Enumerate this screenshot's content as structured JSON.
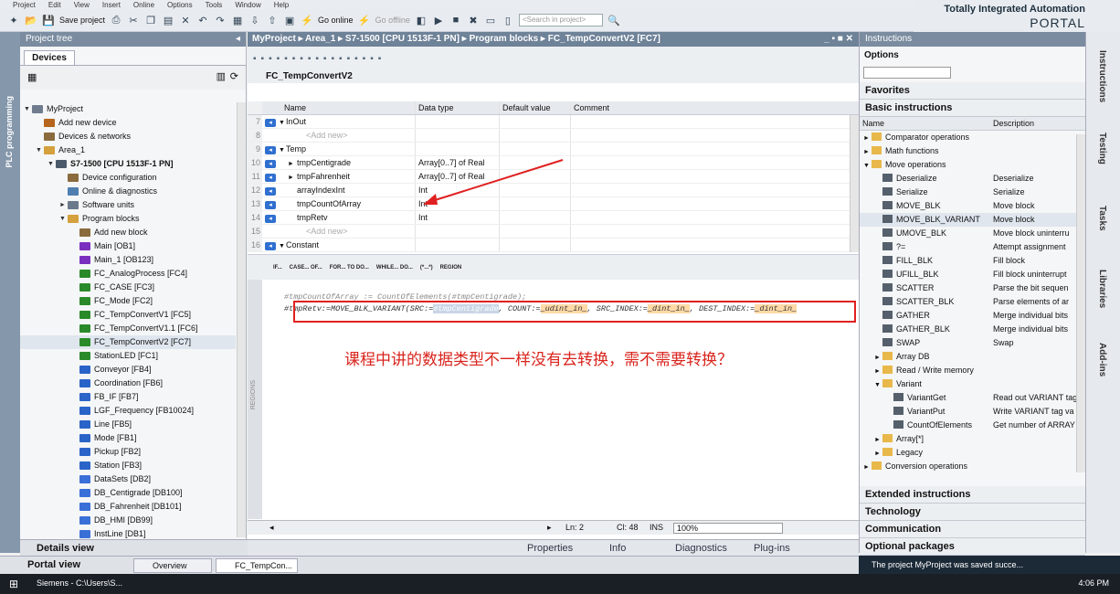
{
  "menu": [
    "Project",
    "Edit",
    "View",
    "Insert",
    "Online",
    "Options",
    "Tools",
    "Window",
    "Help"
  ],
  "toolbar": {
    "save": "Save project",
    "go_online": "Go online",
    "go_offline": "Go offline",
    "search_placeholder": "<Search in project>"
  },
  "brand": {
    "line1": "Totally Integrated Automation",
    "line2": "PORTAL"
  },
  "sidebar_label": "PLC programming",
  "project_tree": {
    "title": "Project tree",
    "tab": "Devices",
    "items": [
      {
        "label": "MyProject",
        "lvl": 0,
        "color": "#6e7c8e",
        "ar": "▼"
      },
      {
        "label": "Add new device",
        "lvl": 1,
        "color": "#b5651d",
        "ar": ""
      },
      {
        "label": "Devices & networks",
        "lvl": 1,
        "color": "#8a6b3d",
        "ar": ""
      },
      {
        "label": "Area_1",
        "lvl": 1,
        "color": "#d4a13d",
        "ar": "▼"
      },
      {
        "label": "S7-1500 [CPU 1513F-1 PN]",
        "lvl": 2,
        "color": "#4a5a6a",
        "ar": "▼",
        "bold": true
      },
      {
        "label": "Device configuration",
        "lvl": 3,
        "color": "#8a6b3d",
        "ar": ""
      },
      {
        "label": "Online & diagnostics",
        "lvl": 3,
        "color": "#4f7fb0",
        "ar": ""
      },
      {
        "label": "Software units",
        "lvl": 3,
        "color": "#6a7a8a",
        "ar": "►"
      },
      {
        "label": "Program blocks",
        "lvl": 3,
        "color": "#d4a13d",
        "ar": "▼"
      },
      {
        "label": "Add new block",
        "lvl": 4,
        "color": "#8a6b3d",
        "ar": ""
      },
      {
        "label": "Main [OB1]",
        "lvl": 4,
        "color": "#7b2fbf",
        "ar": ""
      },
      {
        "label": "Main_1 [OB123]",
        "lvl": 4,
        "color": "#7b2fbf",
        "ar": ""
      },
      {
        "label": "FC_AnalogProcess [FC4]",
        "lvl": 4,
        "color": "#2a8a2a",
        "ar": ""
      },
      {
        "label": "FC_CASE [FC3]",
        "lvl": 4,
        "color": "#2a8a2a",
        "ar": ""
      },
      {
        "label": "FC_Mode [FC2]",
        "lvl": 4,
        "color": "#2a8a2a",
        "ar": ""
      },
      {
        "label": "FC_TempConvertV1 [FC5]",
        "lvl": 4,
        "color": "#2a8a2a",
        "ar": ""
      },
      {
        "label": "FC_TempConvertV1.1 [FC6]",
        "lvl": 4,
        "color": "#2a8a2a",
        "ar": ""
      },
      {
        "label": "FC_TempConvertV2 [FC7]",
        "lvl": 4,
        "color": "#2a8a2a",
        "ar": "",
        "sel": true
      },
      {
        "label": "StationLED [FC1]",
        "lvl": 4,
        "color": "#2a8a2a",
        "ar": ""
      },
      {
        "label": "Conveyor [FB4]",
        "lvl": 4,
        "color": "#2a64c8",
        "ar": ""
      },
      {
        "label": "Coordination [FB6]",
        "lvl": 4,
        "color": "#2a64c8",
        "ar": ""
      },
      {
        "label": "FB_IF [FB7]",
        "lvl": 4,
        "color": "#2a64c8",
        "ar": ""
      },
      {
        "label": "LGF_Frequency [FB10024]",
        "lvl": 4,
        "color": "#2a64c8",
        "ar": ""
      },
      {
        "label": "Line [FB5]",
        "lvl": 4,
        "color": "#2a64c8",
        "ar": ""
      },
      {
        "label": "Mode [FB1]",
        "lvl": 4,
        "color": "#2a64c8",
        "ar": ""
      },
      {
        "label": "Pickup [FB2]",
        "lvl": 4,
        "color": "#2a64c8",
        "ar": ""
      },
      {
        "label": "Station [FB3]",
        "lvl": 4,
        "color": "#2a64c8",
        "ar": ""
      },
      {
        "label": "DataSets [DB2]",
        "lvl": 4,
        "color": "#3a6fd8",
        "ar": ""
      },
      {
        "label": "DB_Centigrade [DB100]",
        "lvl": 4,
        "color": "#3a6fd8",
        "ar": ""
      },
      {
        "label": "DB_Fahrenheit [DB101]",
        "lvl": 4,
        "color": "#3a6fd8",
        "ar": ""
      },
      {
        "label": "DB_HMI [DB99]",
        "lvl": 4,
        "color": "#3a6fd8",
        "ar": ""
      },
      {
        "label": "InstLine [DB1]",
        "lvl": 4,
        "color": "#3a6fd8",
        "ar": ""
      }
    ]
  },
  "editor": {
    "breadcrumb": "MyProject ▸ Area_1 ▸ S7-1500 [CPU 1513F-1 PN] ▸ Program blocks ▸ FC_TempConvertV2 [FC7]",
    "block_name": "FC_TempConvertV2",
    "headers": {
      "name": "Name",
      "type": "Data type",
      "default": "Default value",
      "comment": "Comment"
    },
    "rows": [
      {
        "n": "7",
        "name": "InOut",
        "type": "",
        "io": true,
        "exp": "▼",
        "ind": 0
      },
      {
        "n": "8",
        "name": "<Add new>",
        "type": "",
        "io": false,
        "exp": "",
        "ind": 2,
        "dim": true
      },
      {
        "n": "9",
        "name": "Temp",
        "type": "",
        "io": true,
        "exp": "▼",
        "ind": 0
      },
      {
        "n": "10",
        "name": "tmpCentigrade",
        "type": "Array[0..7] of Real",
        "io": true,
        "exp": "►",
        "ind": 1
      },
      {
        "n": "11",
        "name": "tmpFahrenheit",
        "type": "Array[0..7] of Real",
        "io": true,
        "exp": "►",
        "ind": 1
      },
      {
        "n": "12",
        "name": "arrayIndexInt",
        "type": "Int",
        "io": true,
        "exp": "",
        "ind": 1
      },
      {
        "n": "13",
        "name": "tmpCountOfArray",
        "type": "Int",
        "io": true,
        "exp": "",
        "ind": 1
      },
      {
        "n": "14",
        "name": "tmpRetv",
        "type": "Int",
        "io": true,
        "exp": "",
        "ind": 1
      },
      {
        "n": "15",
        "name": "<Add new>",
        "type": "",
        "io": false,
        "exp": "",
        "ind": 2,
        "dim": true
      },
      {
        "n": "16",
        "name": "Constant",
        "type": "",
        "io": true,
        "exp": "▼",
        "ind": 0
      }
    ],
    "code_tools": [
      "IF...",
      "CASE... OF...",
      "FOR... TO DO...",
      "WHILE... DO...",
      "(*...*)",
      "REGION"
    ],
    "regions_label": "REGIONS",
    "code_line1": "#tmpCountOfArray := CountOfElements(#tmpCentigrade);",
    "code_line2_a": "#tmpRetv:=MOVE_BLK_VARIANT(SRC:=",
    "code_src": "#tmpCentigrade",
    "code_line2_b": ", COUNT:=",
    "code_count": "_udint_in_",
    "code_line2_c": ", SRC_INDEX:=",
    "code_srcidx": "_dint_in_",
    "code_line2_d": ", DEST_INDEX:=",
    "code_destidx": "_dint_in_",
    "annotation": "课程中讲的数据类型不一样没有去转换，需不需要转换？",
    "status": {
      "ln": "Ln: 2",
      "cl": "Cl: 48",
      "ins": "INS",
      "zoom": "100%"
    }
  },
  "bottom_tabs": {
    "properties": "Properties",
    "info": "Info",
    "diagnostics": "Diagnostics",
    "plugins": "Plug-ins"
  },
  "instructions": {
    "title": "Instructions",
    "options": "Options",
    "favorites": "Favorites",
    "basic": "Basic instructions",
    "col_name": "Name",
    "col_desc": "Description",
    "items": [
      {
        "name": "Comparator operations",
        "desc": "",
        "lvl": 0,
        "ar": "►"
      },
      {
        "name": "Math functions",
        "desc": "",
        "lvl": 0,
        "ar": "►"
      },
      {
        "name": "Move operations",
        "desc": "",
        "lvl": 0,
        "ar": "▼"
      },
      {
        "name": "Deserialize",
        "desc": "Deserialize",
        "lvl": 1,
        "ar": ""
      },
      {
        "name": "Serialize",
        "desc": "Serialize",
        "lvl": 1,
        "ar": ""
      },
      {
        "name": "MOVE_BLK",
        "desc": "Move block",
        "lvl": 1,
        "ar": ""
      },
      {
        "name": "MOVE_BLK_VARIANT",
        "desc": "Move block",
        "lvl": 1,
        "ar": "",
        "sel": true
      },
      {
        "name": "UMOVE_BLK",
        "desc": "Move block uninterru",
        "lvl": 1,
        "ar": ""
      },
      {
        "name": "?=",
        "desc": "Attempt assignment",
        "lvl": 1,
        "ar": ""
      },
      {
        "name": "FILL_BLK",
        "desc": "Fill block",
        "lvl": 1,
        "ar": ""
      },
      {
        "name": "UFILL_BLK",
        "desc": "Fill block uninterrupt",
        "lvl": 1,
        "ar": ""
      },
      {
        "name": "SCATTER",
        "desc": "Parse the bit sequen",
        "lvl": 1,
        "ar": ""
      },
      {
        "name": "SCATTER_BLK",
        "desc": "Parse elements of ar",
        "lvl": 1,
        "ar": ""
      },
      {
        "name": "GATHER",
        "desc": "Merge individual bits",
        "lvl": 1,
        "ar": ""
      },
      {
        "name": "GATHER_BLK",
        "desc": "Merge individual bits",
        "lvl": 1,
        "ar": ""
      },
      {
        "name": "SWAP",
        "desc": "Swap",
        "lvl": 1,
        "ar": ""
      },
      {
        "name": "Array DB",
        "desc": "",
        "lvl": 1,
        "ar": "►",
        "folder": true
      },
      {
        "name": "Read / Write memory",
        "desc": "",
        "lvl": 1,
        "ar": "►",
        "folder": true
      },
      {
        "name": "Variant",
        "desc": "",
        "lvl": 1,
        "ar": "▼",
        "folder": true
      },
      {
        "name": "VariantGet",
        "desc": "Read out VARIANT tag",
        "lvl": 2,
        "ar": ""
      },
      {
        "name": "VariantPut",
        "desc": "Write VARIANT tag va",
        "lvl": 2,
        "ar": ""
      },
      {
        "name": "CountOfElements",
        "desc": "Get number of ARRAY",
        "lvl": 2,
        "ar": ""
      },
      {
        "name": "Array[*]",
        "desc": "",
        "lvl": 1,
        "ar": "►",
        "folder": true
      },
      {
        "name": "Legacy",
        "desc": "",
        "lvl": 1,
        "ar": "►",
        "folder": true
      },
      {
        "name": "Conversion operations",
        "desc": "",
        "lvl": 0,
        "ar": "►"
      }
    ],
    "sections": [
      "Extended instructions",
      "Technology",
      "Communication",
      "Optional packages"
    ]
  },
  "right_tabs": [
    "Instructions",
    "Testing",
    "Tasks",
    "Libraries",
    "Add-ins"
  ],
  "details_view": "Details view",
  "portal": {
    "portal_view": "Portal view",
    "overview": "Overview",
    "open_tab": "FC_TempCon..."
  },
  "save_message": "The project MyProject was saved succe...",
  "taskbar": {
    "app": "Siemens - C:\\Users\\S...",
    "time": "4:06 PM"
  }
}
